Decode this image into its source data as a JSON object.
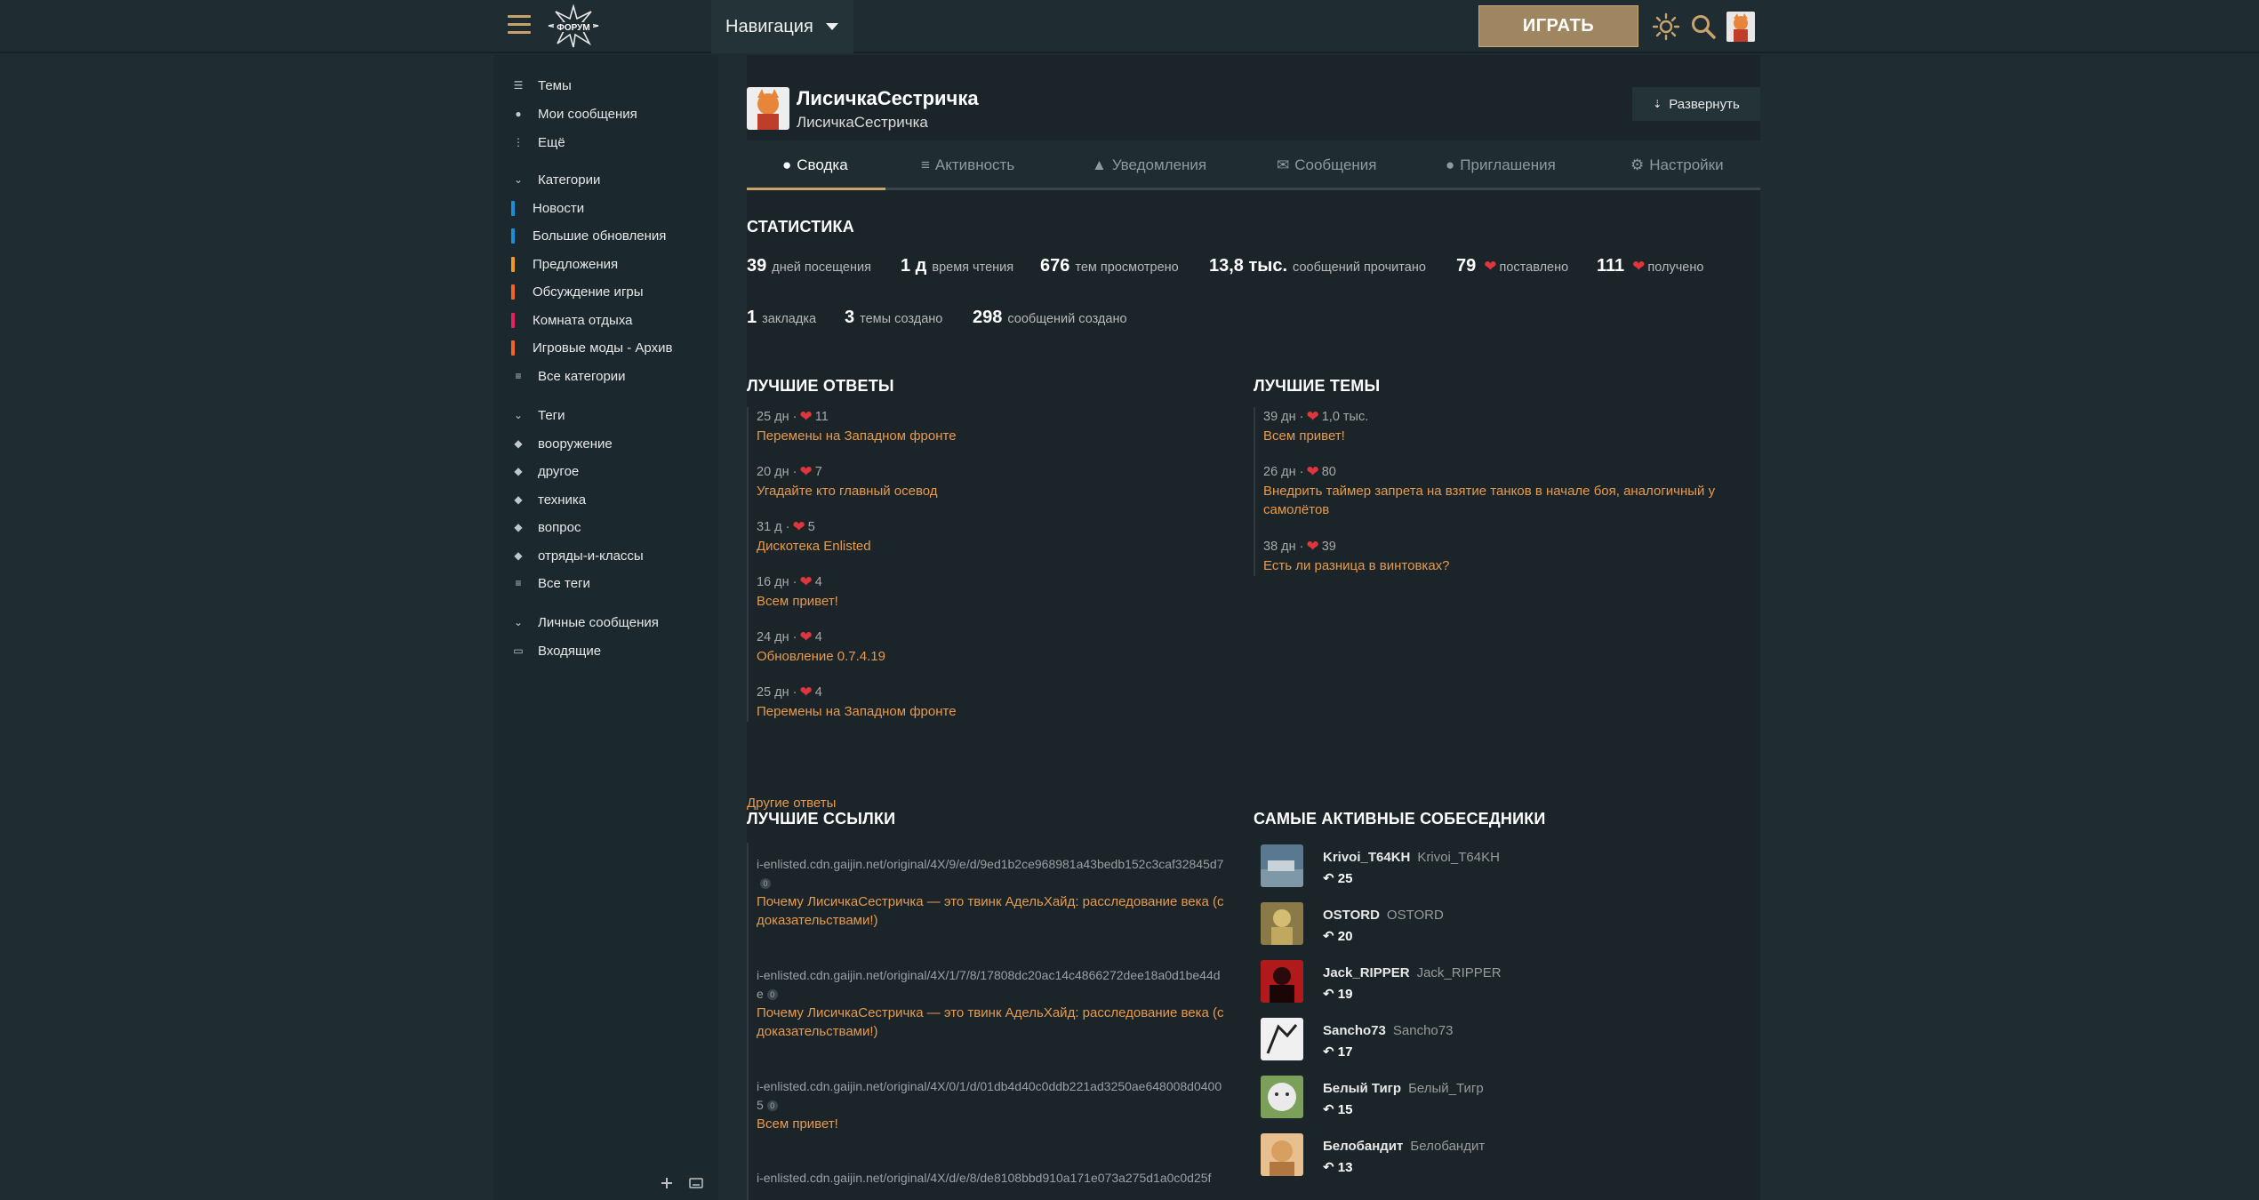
{
  "header": {
    "nav_label": "Навигация",
    "play_label": "ИГРАТЬ",
    "logo_text": "ФОРУМ"
  },
  "sidebar": {
    "top": [
      {
        "label": "Темы",
        "icon": "layers-icon"
      },
      {
        "label": "Мои сообщения",
        "icon": "user-icon"
      },
      {
        "label": "Ещё",
        "icon": "more-vertical-icon"
      }
    ],
    "categories_title": "Категории",
    "categories": [
      {
        "label": "Новости",
        "color": "#1a8fd8"
      },
      {
        "label": "Большие обновления",
        "color": "#1a8fd8"
      },
      {
        "label": "Предложения",
        "color": "#f29b1a"
      },
      {
        "label": "Обсуждение игры",
        "color": "#f26522"
      },
      {
        "label": "Комната отдыха",
        "color": "#e91e63"
      },
      {
        "label": "Игровые моды - Архив",
        "color": "#f26522"
      }
    ],
    "all_categories": "Все категории",
    "tags_title": "Теги",
    "tags": [
      "вооружение",
      "другое",
      "техника",
      "вопрос",
      "отряды-и-классы"
    ],
    "all_tags": "Все теги",
    "pm_title": "Личные сообщения",
    "inbox": "Входящие"
  },
  "user": {
    "name": "ЛисичкаСестричка",
    "login": "ЛисичкаСестричка",
    "expand_label": "Развернуть"
  },
  "tabs": [
    {
      "label": "Сводка",
      "active": true
    },
    {
      "label": "Активность"
    },
    {
      "label": "Уведомления"
    },
    {
      "label": "Сообщения"
    },
    {
      "label": "Приглашения"
    },
    {
      "label": "Настройки"
    }
  ],
  "stats": {
    "title": "СТАТИСТИКА",
    "items": [
      {
        "value": "39",
        "label": "дней посещения"
      },
      {
        "value": "1 д",
        "label": "время чтения"
      },
      {
        "value": "676",
        "label": "тем просмотрено"
      },
      {
        "value": "13,8 тыс.",
        "label": "сообщений прочитано"
      },
      {
        "value": "79",
        "label": "поставлено"
      },
      {
        "value": "111",
        "label": "получено"
      },
      {
        "value": "1",
        "label": "закладка"
      },
      {
        "value": "3",
        "label": "темы создано"
      },
      {
        "value": "298",
        "label": "сообщений создано"
      }
    ]
  },
  "best_replies": {
    "title": "ЛУЧШИЕ ОТВЕТЫ",
    "items": [
      {
        "age": "25 дн ·",
        "likes": "11",
        "title": "Перемены на Западном фронте"
      },
      {
        "age": "20 дн ·",
        "likes": "7",
        "title": "Угадайте кто главный осевод"
      },
      {
        "age": "31 д ·",
        "likes": "5",
        "title": "Дискотека Enlisted"
      },
      {
        "age": "16 дн ·",
        "likes": "4",
        "title": "Всем привет!"
      },
      {
        "age": "24 дн ·",
        "likes": "4",
        "title": "Обновление 0.7.4.19"
      },
      {
        "age": "25 дн ·",
        "likes": "4",
        "title": "Перемены на Западном фронте"
      }
    ],
    "more": "Другие ответы"
  },
  "best_topics": {
    "title": "ЛУЧШИЕ ТЕМЫ",
    "items": [
      {
        "age": "39 дн ·",
        "likes": "1,0 тыс.",
        "title": "Всем привет!"
      },
      {
        "age": "26 дн ·",
        "likes": "80",
        "title": "Внедрить таймер запрета на взятие танков в начале боя, аналогичный у самолётов"
      },
      {
        "age": "38 дн ·",
        "likes": "39",
        "title": "Есть ли разница в винтовках?"
      }
    ]
  },
  "best_links": {
    "title": "ЛУЧШИЕ ССЫЛКИ",
    "items": [
      {
        "url": "i-enlisted.cdn.gaijin.net/original/4X/9/e/d/9ed1b2ce968981a43bedb152c3caf32845d7",
        "count": "0",
        "title": "Почему ЛисичкаСестричка — это твинк АдельХайд: расследование века (с доказательствами!)"
      },
      {
        "url": "i-enlisted.cdn.gaijin.net/original/4X/1/7/8/17808dc20ac14c4866272dee18a0d1be44de",
        "count": "0",
        "title": "Почему ЛисичкаСестричка — это твинк АдельХайд: расследование века (с доказательствами!)"
      },
      {
        "url": "i-enlisted.cdn.gaijin.net/original/4X/0/1/d/01db4d40c0ddb221ad3250ae648008d04005",
        "count": "0",
        "title": "Всем привет!"
      },
      {
        "url": "i-enlisted.cdn.gaijin.net/original/4X/d/e/8/de8108bbd910a171e073a275d1a0c0d25f",
        "count": "",
        "title": ""
      }
    ]
  },
  "active_partners": {
    "title": "САМЫЕ АКТИВНЫЕ СОБЕСЕДНИКИ",
    "items": [
      {
        "name": "Krivoi_T64KH",
        "login": "Krivoi_T64KH",
        "replies": "25",
        "color": "#5a7890"
      },
      {
        "name": "OSTORD",
        "login": "OSTORD",
        "replies": "20",
        "color": "#b49a55"
      },
      {
        "name": "Jack_RIPPER",
        "login": "Jack_RIPPER",
        "replies": "19",
        "color": "#b01a1a"
      },
      {
        "name": "Sancho73",
        "login": "Sancho73",
        "replies": "17",
        "color": "#cfcfcf"
      },
      {
        "name": "Белый Тигр",
        "login": "Белый_Тигр",
        "replies": "15",
        "color": "#8aa86a"
      },
      {
        "name": "Белобандит",
        "login": "Белобандит",
        "replies": "13",
        "color": "#d8a060"
      }
    ]
  }
}
